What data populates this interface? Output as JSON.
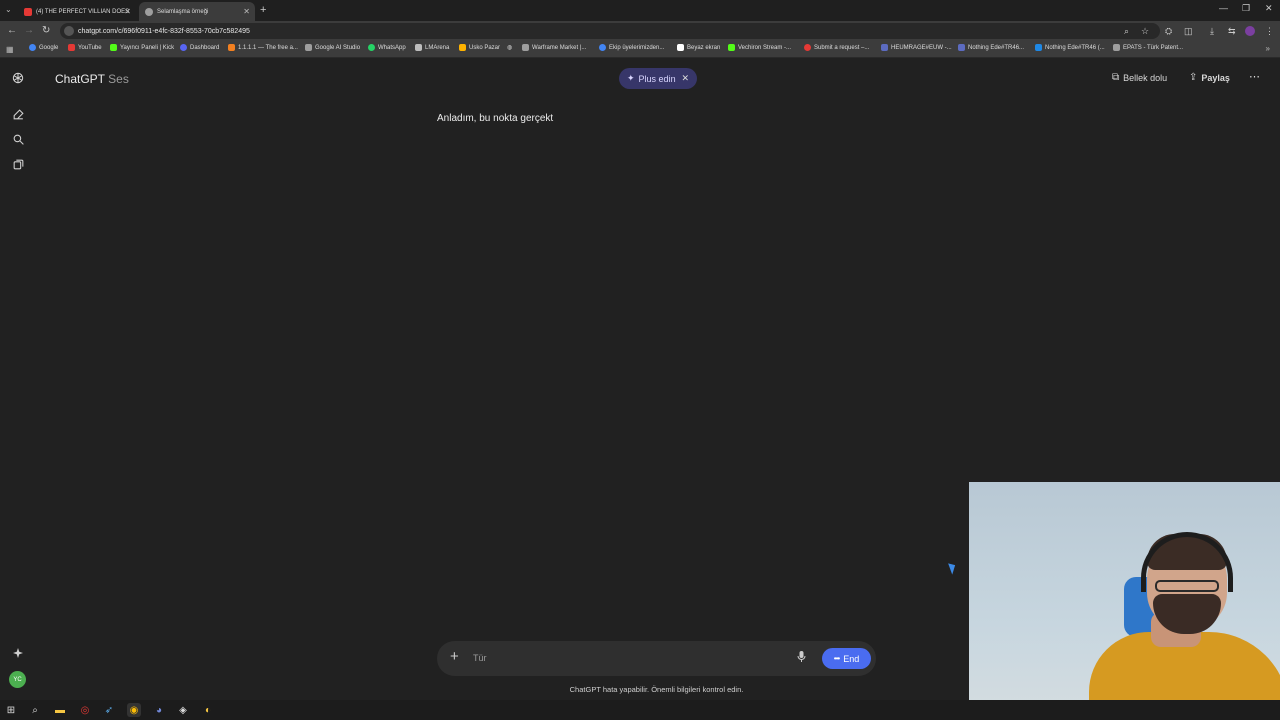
{
  "browser": {
    "tabs": [
      {
        "label": "(4) THE PERFECT VILLIAN DOES",
        "active": false,
        "favicon_color": "#e53935"
      },
      {
        "label": "Selamlaşma örneği",
        "active": true,
        "favicon_color": "#9e9e9e"
      }
    ],
    "new_tab_glyph": "+",
    "url": "chatgpt.com/c/696f0911-e4fc-832f-8553-70cb7c582495",
    "bookmarks": [
      {
        "label": "Google",
        "icon_color": "#4285f4"
      },
      {
        "label": "YouTube",
        "icon_color": "#e53935"
      },
      {
        "label": "Yayıncı Paneli | Kick",
        "icon_color": "#53fc18"
      },
      {
        "label": "Dashboard",
        "icon_color": "#5865f2"
      },
      {
        "label": "1.1.1.1 — The free a...",
        "icon_color": "#f38020"
      },
      {
        "label": "Google AI Studio",
        "icon_color": "#9e9e9e"
      },
      {
        "label": "WhatsApp",
        "icon_color": "#25d366"
      },
      {
        "label": "LMArena",
        "icon_color": "#bdbdbd"
      },
      {
        "label": "Usko Pazar",
        "icon_color": "#ffb300"
      },
      {
        "label": "Warframe Market |...",
        "icon_color": "#9e9e9e"
      },
      {
        "label": "Ekip üyelerimizden...",
        "icon_color": "#4285f4"
      },
      {
        "label": "Beyaz ekran",
        "icon_color": "#ffffff"
      },
      {
        "label": "Vechiron Stream -...",
        "icon_color": "#53fc18"
      },
      {
        "label": "Submit a request –...",
        "icon_color": "#e53935"
      },
      {
        "label": "HEUMRAGE#EUW -...",
        "icon_color": "#5c6bc0"
      },
      {
        "label": "Nothing Ede#TR46...",
        "icon_color": "#5c6bc0"
      },
      {
        "label": "Nothing Ede#TR46 (...",
        "icon_color": "#1e88e5"
      },
      {
        "label": "EPATS - Türk Patent...",
        "icon_color": "#9e9e9e"
      }
    ]
  },
  "app": {
    "title": "ChatGPT",
    "mode": "Ses",
    "plus_label": "Plus edin",
    "memory_label": "Bellek dolu",
    "share_label": "Paylaş",
    "message": "Anladım, bu nokta gerçekt",
    "composer_placeholder": "Tür",
    "end_label": "End",
    "disclaimer": "ChatGPT hata yapabilir. Önemli bilgileri kontrol edin.",
    "avatar_initials": "YC",
    "accent": "#4a6cf0",
    "plus_pill_color": "#373669"
  }
}
